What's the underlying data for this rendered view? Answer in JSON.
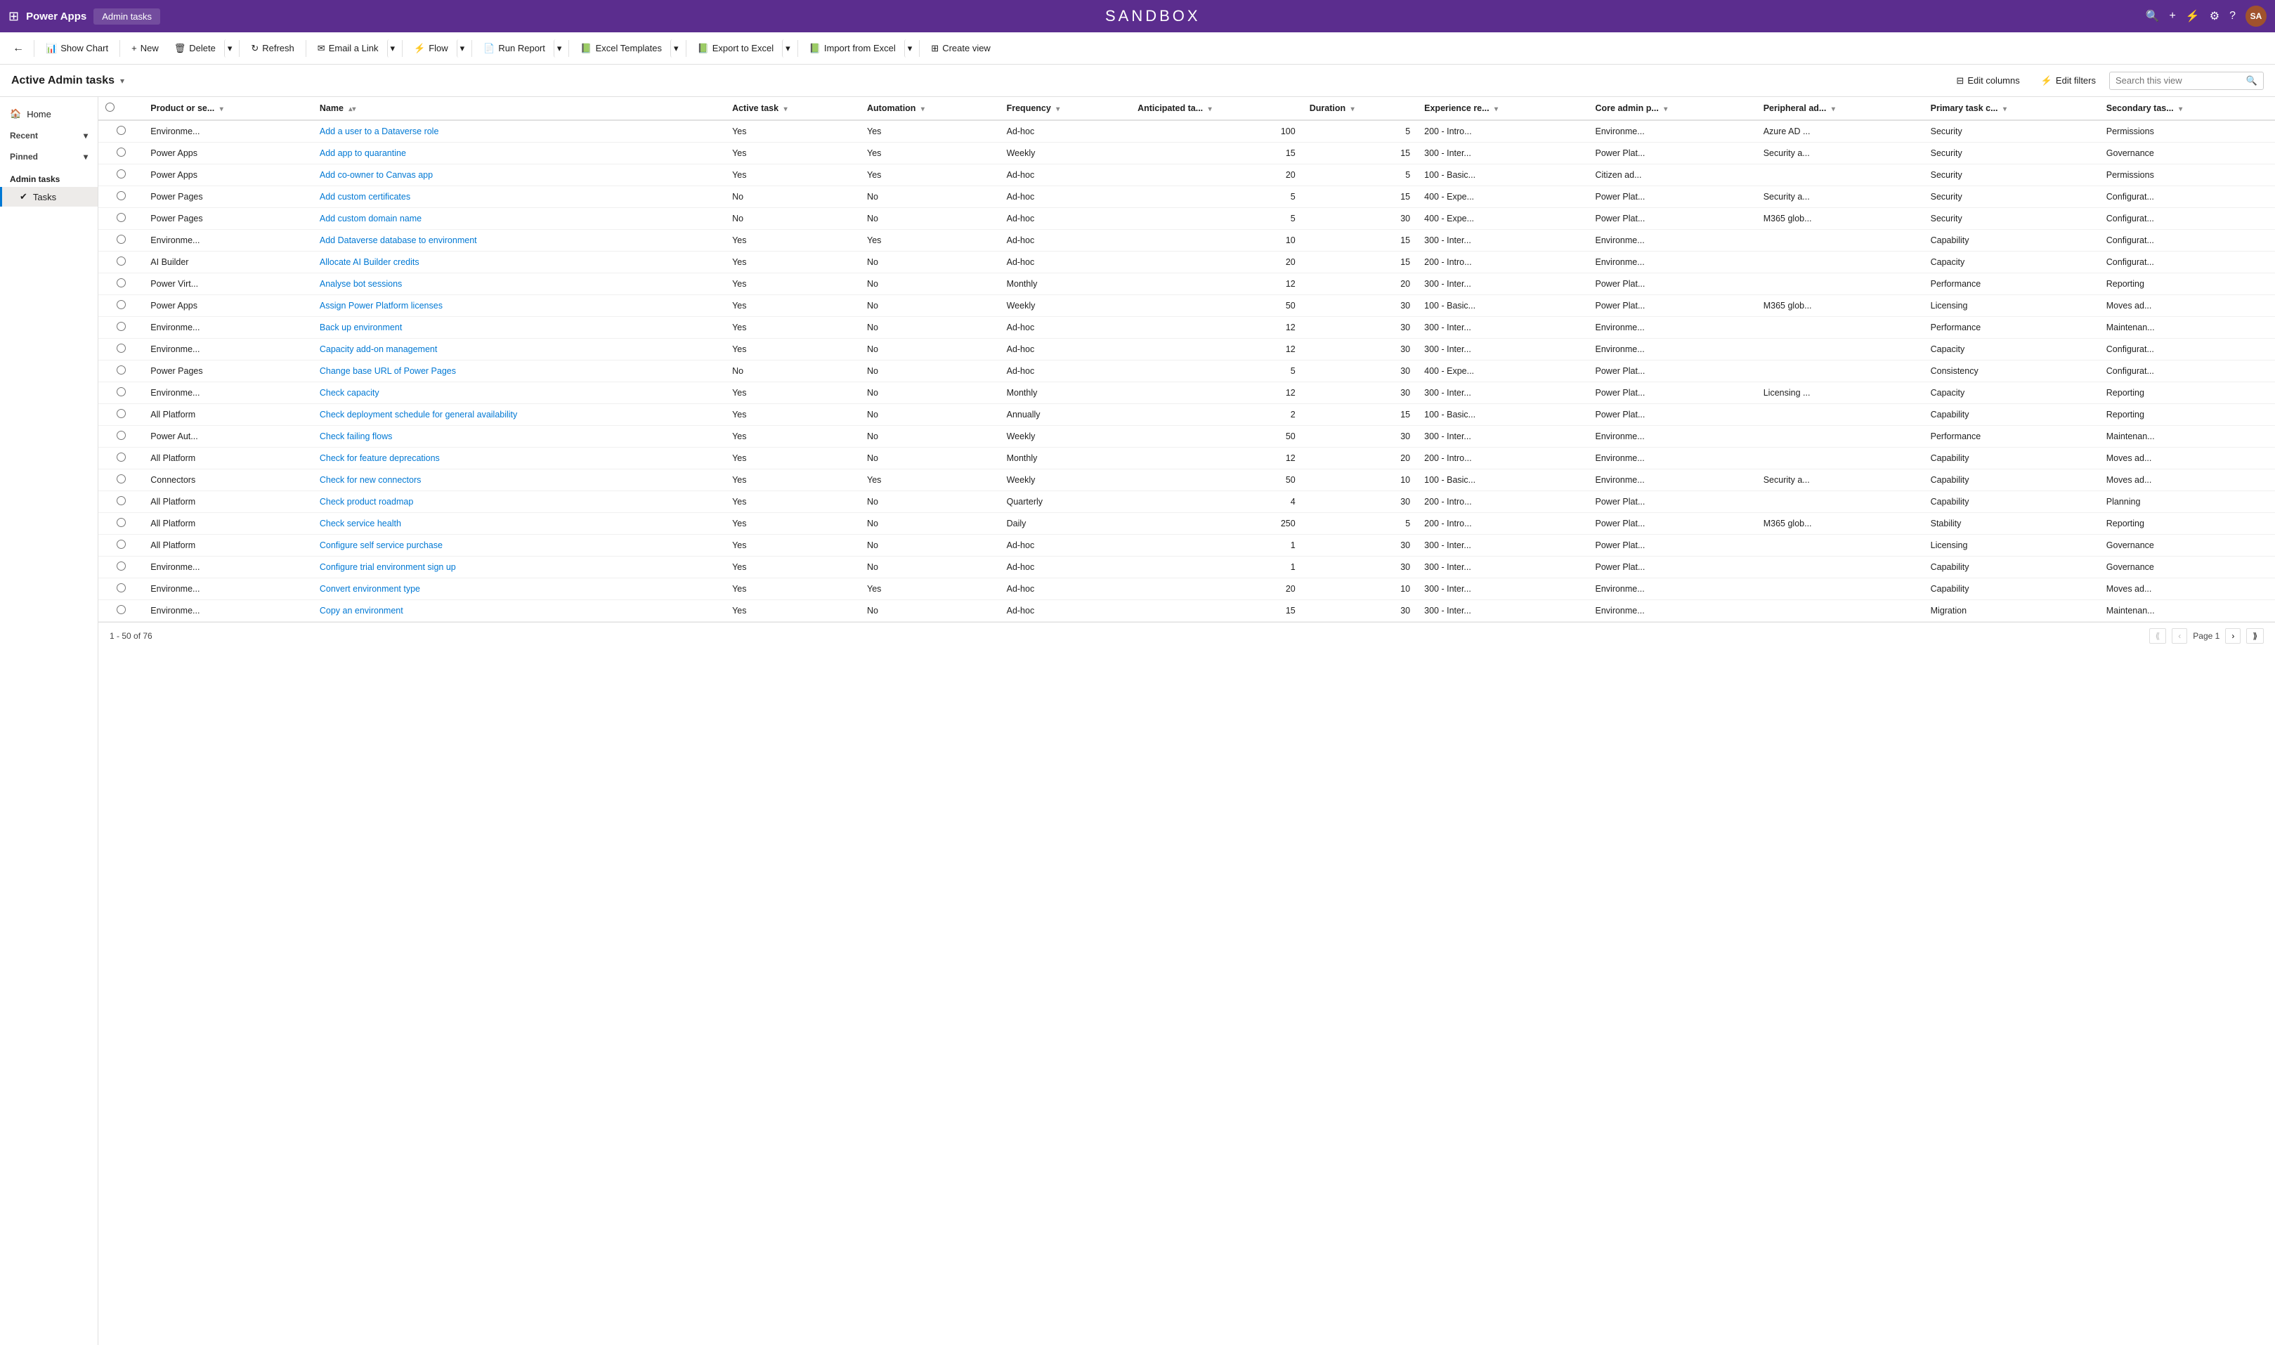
{
  "app": {
    "waffle_icon": "⊞",
    "name": "Power Apps",
    "breadcrumb": "Admin tasks",
    "sandbox_title": "SANDBOX",
    "top_icons": [
      "🔍",
      "+",
      "⚙",
      "⚙",
      "?"
    ],
    "avatar_label": "SA"
  },
  "toolbar": {
    "back_label": "←",
    "show_chart_label": "Show Chart",
    "new_label": "New",
    "delete_label": "Delete",
    "refresh_label": "Refresh",
    "email_link_label": "Email a Link",
    "flow_label": "Flow",
    "run_report_label": "Run Report",
    "excel_templates_label": "Excel Templates",
    "export_excel_label": "Export to Excel",
    "import_excel_label": "Import from Excel",
    "create_view_label": "Create view"
  },
  "sub_toolbar": {
    "view_title": "Active Admin tasks",
    "edit_columns_label": "Edit columns",
    "edit_filters_label": "Edit filters",
    "search_placeholder": "Search this view"
  },
  "sidebar": {
    "home_label": "Home",
    "recent_label": "Recent",
    "pinned_label": "Pinned",
    "group_title": "Admin tasks",
    "tasks_label": "Tasks"
  },
  "table": {
    "columns": [
      "Product or se...",
      "Name",
      "Active task",
      "Automation",
      "Frequency",
      "Anticipated ta...",
      "Duration",
      "Experience re...",
      "Core admin p...",
      "Peripheral ad...",
      "Primary task c...",
      "Secondary tas..."
    ],
    "rows": [
      {
        "product": "Environme...",
        "name": "Add a user to a Dataverse role",
        "active": "Yes",
        "automation": "Yes",
        "frequency": "Ad-hoc",
        "anticipated": "100",
        "duration": "5",
        "experience": "200 - Intro...",
        "core": "Environme...",
        "peripheral": "Azure AD ...",
        "primary": "Security",
        "secondary": "Permissions"
      },
      {
        "product": "Power Apps",
        "name": "Add app to quarantine",
        "active": "Yes",
        "automation": "Yes",
        "frequency": "Weekly",
        "anticipated": "15",
        "duration": "15",
        "experience": "300 - Inter...",
        "core": "Power Plat...",
        "peripheral": "Security a...",
        "primary": "Security",
        "secondary": "Governance"
      },
      {
        "product": "Power Apps",
        "name": "Add co-owner to Canvas app",
        "active": "Yes",
        "automation": "Yes",
        "frequency": "Ad-hoc",
        "anticipated": "20",
        "duration": "5",
        "experience": "100 - Basic...",
        "core": "Citizen ad...",
        "peripheral": "",
        "primary": "Security",
        "secondary": "Permissions"
      },
      {
        "product": "Power Pages",
        "name": "Add custom certificates",
        "active": "No",
        "automation": "No",
        "frequency": "Ad-hoc",
        "anticipated": "5",
        "duration": "15",
        "experience": "400 - Expe...",
        "core": "Power Plat...",
        "peripheral": "Security a...",
        "primary": "Security",
        "secondary": "Configurat..."
      },
      {
        "product": "Power Pages",
        "name": "Add custom domain name",
        "active": "No",
        "automation": "No",
        "frequency": "Ad-hoc",
        "anticipated": "5",
        "duration": "30",
        "experience": "400 - Expe...",
        "core": "Power Plat...",
        "peripheral": "M365 glob...",
        "primary": "Security",
        "secondary": "Configurat..."
      },
      {
        "product": "Environme...",
        "name": "Add Dataverse database to environment",
        "active": "Yes",
        "automation": "Yes",
        "frequency": "Ad-hoc",
        "anticipated": "10",
        "duration": "15",
        "experience": "300 - Inter...",
        "core": "Environme...",
        "peripheral": "",
        "primary": "Capability",
        "secondary": "Configurat..."
      },
      {
        "product": "AI Builder",
        "name": "Allocate AI Builder credits",
        "active": "Yes",
        "automation": "No",
        "frequency": "Ad-hoc",
        "anticipated": "20",
        "duration": "15",
        "experience": "200 - Intro...",
        "core": "Environme...",
        "peripheral": "",
        "primary": "Capacity",
        "secondary": "Configurat..."
      },
      {
        "product": "Power Virt...",
        "name": "Analyse bot sessions",
        "active": "Yes",
        "automation": "No",
        "frequency": "Monthly",
        "anticipated": "12",
        "duration": "20",
        "experience": "300 - Inter...",
        "core": "Power Plat...",
        "peripheral": "",
        "primary": "Performance",
        "secondary": "Reporting"
      },
      {
        "product": "Power Apps",
        "name": "Assign Power Platform licenses",
        "active": "Yes",
        "automation": "No",
        "frequency": "Weekly",
        "anticipated": "50",
        "duration": "30",
        "experience": "100 - Basic...",
        "core": "Power Plat...",
        "peripheral": "M365 glob...",
        "primary": "Licensing",
        "secondary": "Moves ad..."
      },
      {
        "product": "Environme...",
        "name": "Back up environment",
        "active": "Yes",
        "automation": "No",
        "frequency": "Ad-hoc",
        "anticipated": "12",
        "duration": "30",
        "experience": "300 - Inter...",
        "core": "Environme...",
        "peripheral": "",
        "primary": "Performance",
        "secondary": "Maintenan..."
      },
      {
        "product": "Environme...",
        "name": "Capacity add-on management",
        "active": "Yes",
        "automation": "No",
        "frequency": "Ad-hoc",
        "anticipated": "12",
        "duration": "30",
        "experience": "300 - Inter...",
        "core": "Environme...",
        "peripheral": "",
        "primary": "Capacity",
        "secondary": "Configurat..."
      },
      {
        "product": "Power Pages",
        "name": "Change base URL of Power Pages",
        "active": "No",
        "automation": "No",
        "frequency": "Ad-hoc",
        "anticipated": "5",
        "duration": "30",
        "experience": "400 - Expe...",
        "core": "Power Plat...",
        "peripheral": "",
        "primary": "Consistency",
        "secondary": "Configurat..."
      },
      {
        "product": "Environme...",
        "name": "Check capacity",
        "active": "Yes",
        "automation": "No",
        "frequency": "Monthly",
        "anticipated": "12",
        "duration": "30",
        "experience": "300 - Inter...",
        "core": "Power Plat...",
        "peripheral": "Licensing ...",
        "primary": "Capacity",
        "secondary": "Reporting"
      },
      {
        "product": "All Platform",
        "name": "Check deployment schedule for general availability",
        "active": "Yes",
        "automation": "No",
        "frequency": "Annually",
        "anticipated": "2",
        "duration": "15",
        "experience": "100 - Basic...",
        "core": "Power Plat...",
        "peripheral": "",
        "primary": "Capability",
        "secondary": "Reporting"
      },
      {
        "product": "Power Aut...",
        "name": "Check failing flows",
        "active": "Yes",
        "automation": "No",
        "frequency": "Weekly",
        "anticipated": "50",
        "duration": "30",
        "experience": "300 - Inter...",
        "core": "Environme...",
        "peripheral": "",
        "primary": "Performance",
        "secondary": "Maintenan..."
      },
      {
        "product": "All Platform",
        "name": "Check for feature deprecations",
        "active": "Yes",
        "automation": "No",
        "frequency": "Monthly",
        "anticipated": "12",
        "duration": "20",
        "experience": "200 - Intro...",
        "core": "Environme...",
        "peripheral": "",
        "primary": "Capability",
        "secondary": "Moves ad..."
      },
      {
        "product": "Connectors",
        "name": "Check for new connectors",
        "active": "Yes",
        "automation": "Yes",
        "frequency": "Weekly",
        "anticipated": "50",
        "duration": "10",
        "experience": "100 - Basic...",
        "core": "Environme...",
        "peripheral": "Security a...",
        "primary": "Capability",
        "secondary": "Moves ad..."
      },
      {
        "product": "All Platform",
        "name": "Check product roadmap",
        "active": "Yes",
        "automation": "No",
        "frequency": "Quarterly",
        "anticipated": "4",
        "duration": "30",
        "experience": "200 - Intro...",
        "core": "Power Plat...",
        "peripheral": "",
        "primary": "Capability",
        "secondary": "Planning"
      },
      {
        "product": "All Platform",
        "name": "Check service health",
        "active": "Yes",
        "automation": "No",
        "frequency": "Daily",
        "anticipated": "250",
        "duration": "5",
        "experience": "200 - Intro...",
        "core": "Power Plat...",
        "peripheral": "M365 glob...",
        "primary": "Stability",
        "secondary": "Reporting"
      },
      {
        "product": "All Platform",
        "name": "Configure self service purchase",
        "active": "Yes",
        "automation": "No",
        "frequency": "Ad-hoc",
        "anticipated": "1",
        "duration": "30",
        "experience": "300 - Inter...",
        "core": "Power Plat...",
        "peripheral": "",
        "primary": "Licensing",
        "secondary": "Governance"
      },
      {
        "product": "Environme...",
        "name": "Configure trial environment sign up",
        "active": "Yes",
        "automation": "No",
        "frequency": "Ad-hoc",
        "anticipated": "1",
        "duration": "30",
        "experience": "300 - Inter...",
        "core": "Power Plat...",
        "peripheral": "",
        "primary": "Capability",
        "secondary": "Governance"
      },
      {
        "product": "Environme...",
        "name": "Convert environment type",
        "active": "Yes",
        "automation": "Yes",
        "frequency": "Ad-hoc",
        "anticipated": "20",
        "duration": "10",
        "experience": "300 - Inter...",
        "core": "Environme...",
        "peripheral": "",
        "primary": "Capability",
        "secondary": "Moves ad..."
      },
      {
        "product": "Environme...",
        "name": "Copy an environment",
        "active": "Yes",
        "automation": "No",
        "frequency": "Ad-hoc",
        "anticipated": "15",
        "duration": "30",
        "experience": "300 - Inter...",
        "core": "Environme...",
        "peripheral": "",
        "primary": "Migration",
        "secondary": "Maintenan..."
      }
    ]
  },
  "footer": {
    "count_label": "1 - 50 of 76",
    "page_label": "Page 1"
  }
}
